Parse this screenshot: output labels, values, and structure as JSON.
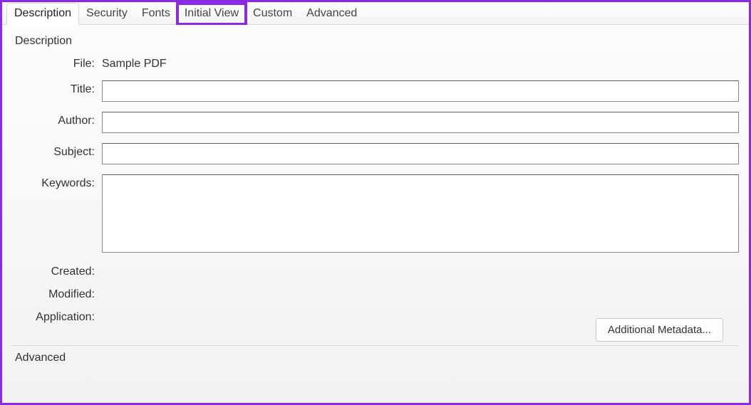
{
  "tabs": {
    "description": "Description",
    "security": "Security",
    "fonts": "Fonts",
    "initial_view": "Initial View",
    "custom": "Custom",
    "advanced": "Advanced"
  },
  "description_group": {
    "heading": "Description",
    "file_label": "File:",
    "file_value": "Sample PDF",
    "title_label": "Title:",
    "title_value": "",
    "author_label": "Author:",
    "author_value": "",
    "subject_label": "Subject:",
    "subject_value": "",
    "keywords_label": "Keywords:",
    "keywords_value": "",
    "created_label": "Created:",
    "created_value": "",
    "modified_label": "Modified:",
    "modified_value": "",
    "application_label": "Application:",
    "application_value": "",
    "additional_metadata_button": "Additional Metadata..."
  },
  "advanced_group": {
    "heading": "Advanced"
  }
}
